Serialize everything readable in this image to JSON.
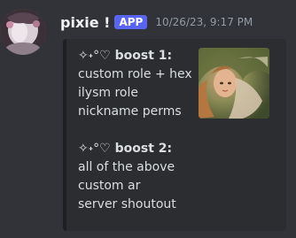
{
  "message": {
    "avatar_icon": "user-avatar",
    "username": "pixie !",
    "badge": "APP",
    "timestamp": "10/26/23, 9:17 PM"
  },
  "embed": {
    "border_color": "#1e1f22",
    "thumbnail_icon": "fairy-portrait-image",
    "sections": [
      {
        "sparkle": "✧˖°♡",
        "heading": "boost 1:",
        "lines": [
          "custom role + hex",
          "ilysm role",
          "nickname perms"
        ]
      },
      {
        "sparkle": "✧˖°♡",
        "heading": "boost 2:",
        "lines": [
          "all of the above",
          "custom ar",
          "server shoutout"
        ]
      }
    ]
  },
  "colors": {
    "background": "#313338",
    "embed_background": "#2b2d31",
    "badge": "#5865f2",
    "username": "#f2f3f5",
    "text": "#dbdee1",
    "timestamp": "#949ba4"
  }
}
